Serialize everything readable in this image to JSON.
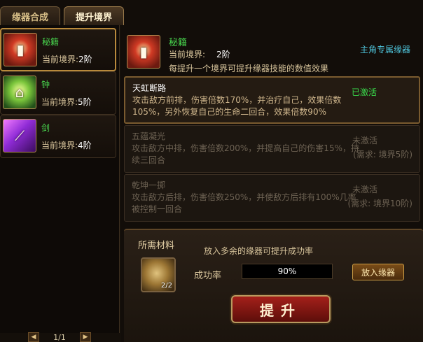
{
  "tabs": [
    {
      "label": "缘器合成"
    },
    {
      "label": "提升境界"
    }
  ],
  "items": [
    {
      "name": "秘籍",
      "lvl_label": "当前境界:",
      "lvl": "2阶",
      "icon": "book-icon"
    },
    {
      "name": "钟",
      "lvl_label": "当前境界:",
      "lvl": "5阶",
      "icon": "bell-icon"
    },
    {
      "name": "剑",
      "lvl_label": "当前境界:",
      "lvl": "4阶",
      "icon": "sword-icon"
    }
  ],
  "pager": {
    "prev": "◀",
    "text": "1/1",
    "next": "▶"
  },
  "detail": {
    "name": "秘籍",
    "lvl_label": "当前境界:",
    "lvl": "2阶",
    "desc": "每提升一个境界可提升缘器技能的数值效果",
    "tag": "主角专属缘器"
  },
  "skills": [
    {
      "name": "天虹断路",
      "desc": "攻击敌方前排，伤害倍数170%，并治疗自己，效果倍数105%，另外恢复自己的生命二回合，效果倍数90%",
      "state": "已激活",
      "req": ""
    },
    {
      "name": "五蕴凝光",
      "desc": "攻击敌方中排，伤害倍数200%，并提高自己的伤害15%，持续三回合",
      "state": "未激活",
      "req": "(需求: 境界5阶)"
    },
    {
      "name": "乾坤一掷",
      "desc": "攻击敌方后排，伤害倍数250%，并使敌方后排有100%几率被控制一回合",
      "state": "未激活",
      "req": "(需求: 境界10阶)"
    }
  ],
  "materials": {
    "title": "所需材料",
    "hint": "放入多余的缘器可提升成功率",
    "slot_count": "2/2",
    "rate_label": "成功率",
    "rate": "90%",
    "put_label": "放入缘器",
    "upgrade_label": "提升"
  }
}
